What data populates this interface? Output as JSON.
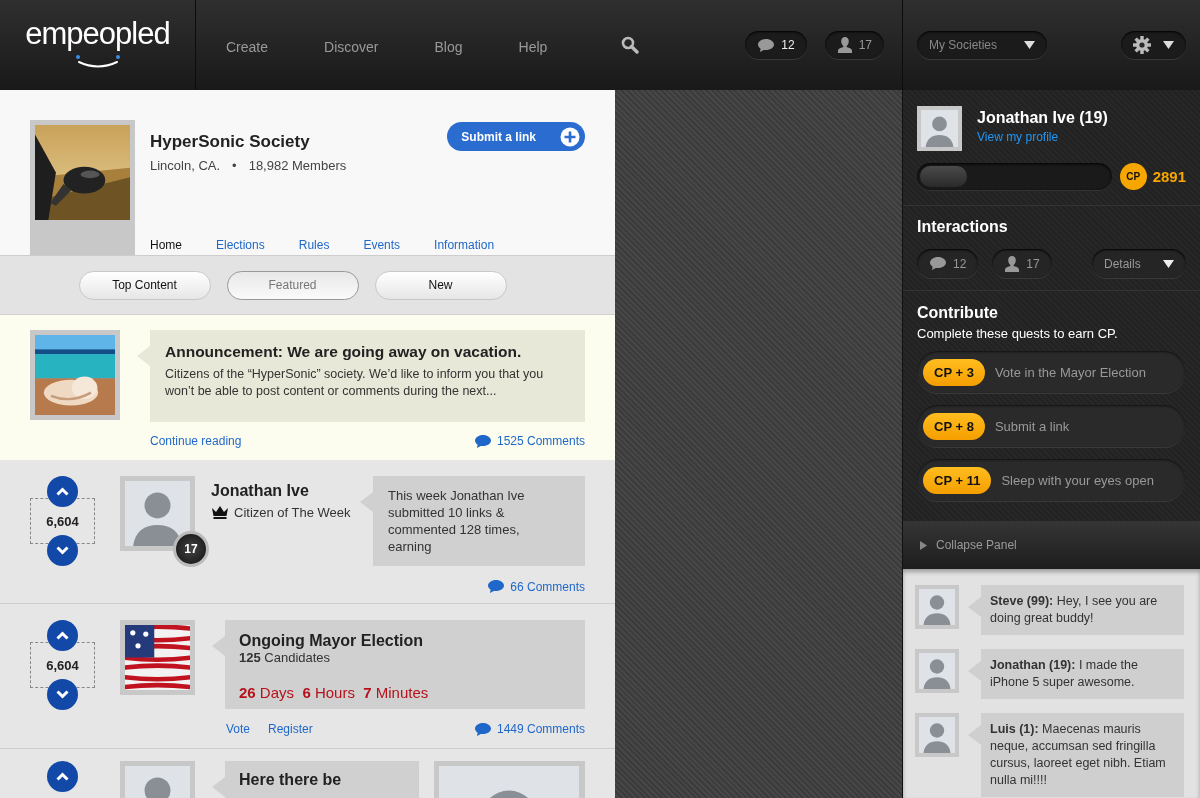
{
  "header": {
    "logo": "empeopled",
    "nav": [
      {
        "label": "Create"
      },
      {
        "label": "Discover"
      },
      {
        "label": "Blog"
      },
      {
        "label": "Help"
      }
    ],
    "messages": "12",
    "followers": "17",
    "societies_menu": "My Societies"
  },
  "society": {
    "name": "HyperSonic Society",
    "location": "Lincoln, CA.",
    "separator": "•",
    "members": "18,982 Members",
    "submit_button": "Submit a link",
    "nav": [
      {
        "label": "Home",
        "selected": true
      },
      {
        "label": "Elections",
        "selected": false
      },
      {
        "label": "Rules",
        "selected": false
      },
      {
        "label": "Events",
        "selected": false
      },
      {
        "label": "Information",
        "selected": false
      }
    ]
  },
  "feed_tabs": [
    {
      "label": "Top Content",
      "selected": false
    },
    {
      "label": "Featured",
      "selected": true
    },
    {
      "label": "New",
      "selected": false
    }
  ],
  "feed": [
    {
      "kind": "announcement",
      "title": "Announcement: We are going away on vacation.",
      "body": "Citizens of the “HyperSonic” society. We’d like to inform you that you won’t be able to post content or comments during the next...",
      "link": "Continue reading",
      "comments": "1525 Comments"
    },
    {
      "kind": "citizen",
      "score": "6,604",
      "name": "Jonathan Ive",
      "subtitle": "Citizen of The Week",
      "badge": "17",
      "blurb": "This week Jonathan Ive submitted 10 links & commented 128 times, earning",
      "comments": "66 Comments"
    },
    {
      "kind": "election",
      "score": "6,604",
      "title": "Ongoing Mayor Election",
      "candidates": "**125** Candidates",
      "countdown": "**26** Days  **6** Hours  **7** Minutes",
      "links": [
        "Vote",
        "Register"
      ],
      "comments": "1449 Comments"
    },
    {
      "kind": "partial",
      "title": "Here there be"
    }
  ],
  "profile": {
    "name": "Jonathan Ive (19)",
    "link": "View my profile",
    "level": 0.25,
    "cp_label": "CP",
    "cp": "2891"
  },
  "interactions": {
    "title": "Interactions",
    "messages": "12",
    "followers": "17",
    "details": "Details"
  },
  "contribute": {
    "title": "Contribute",
    "subtitle": "Complete these quests to earn CP.",
    "quests": [
      {
        "reward": "CP + 3",
        "label": "Vote in the Mayor Election"
      },
      {
        "reward": "CP + 8",
        "label": "Submit a link"
      },
      {
        "reward": "CP + 11",
        "label": "Sleep with your eyes open"
      }
    ]
  },
  "collapse": "Collapse Panel",
  "comments": [
    {
      "text": "**Steve (99):** Hey, I see you are doing great buddy!"
    },
    {
      "text": "**Jonathan (19):** I made the iPhone 5 super awesome."
    },
    {
      "text": "**Luis (1):** Maecenas mauris neque, accumsan sed fringilla cursus, laoreet eget nibh. Etiam nulla mi!!!!"
    }
  ]
}
